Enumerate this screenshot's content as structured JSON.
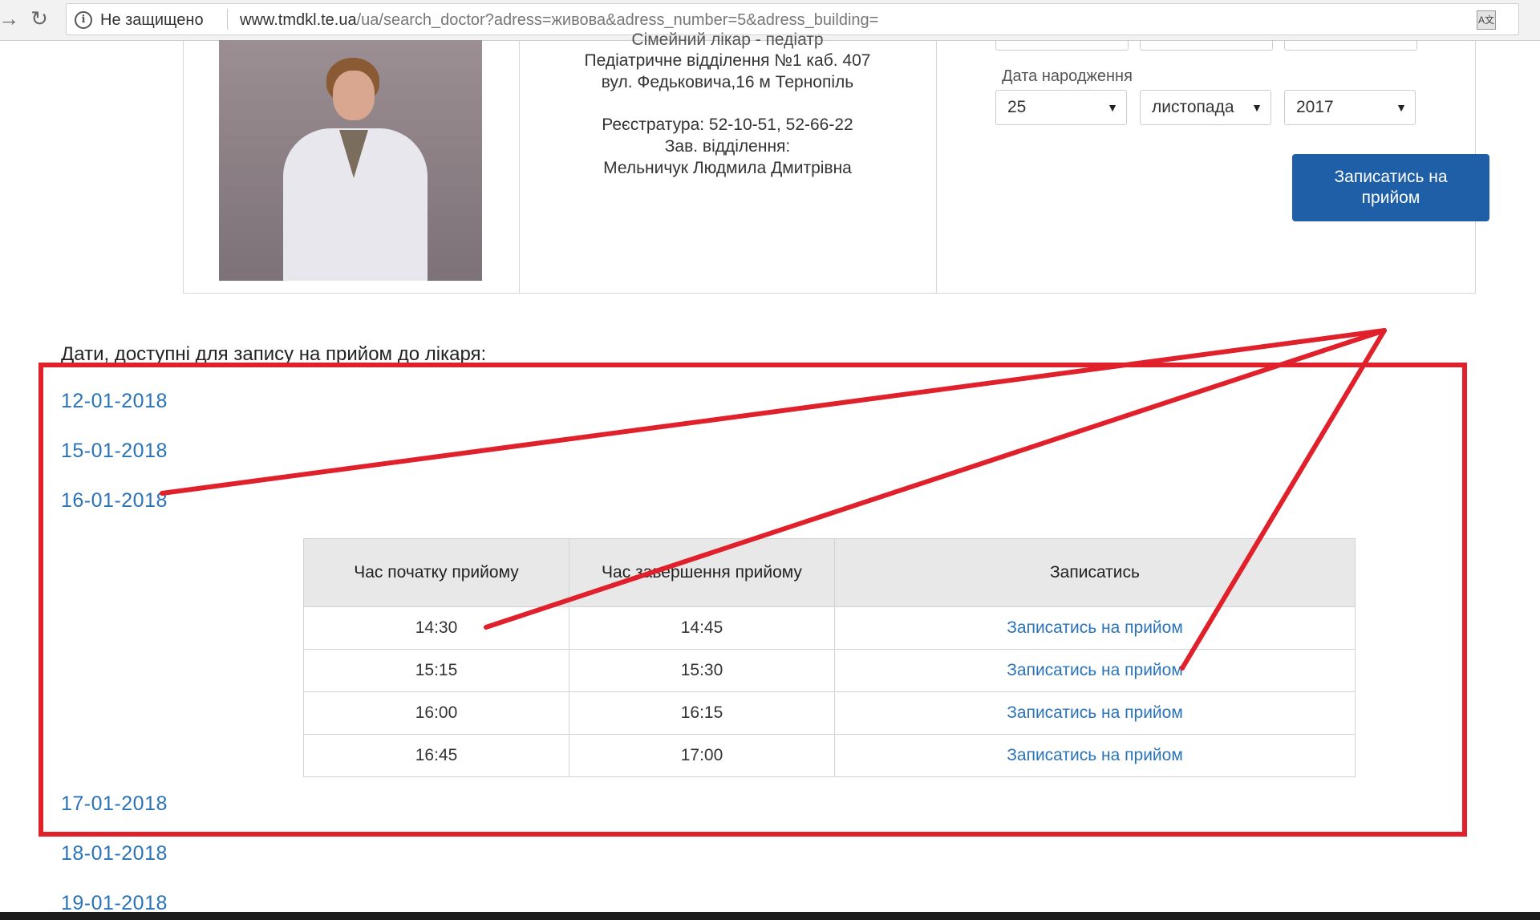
{
  "browser": {
    "security_text": "Не защищено",
    "url_host": "www.tmdkl.te.ua",
    "url_path": "/ua/search_doctor?adress=живова&adress_number=5&adress_building="
  },
  "doctor": {
    "cut_off_line": "Сімейний лікар - педіатр",
    "department": "Педіатричне відділення №1  каб. 407",
    "address": "вул. Федьковича,16 м Тернопіль",
    "registry": "Реєстратура: 52-10-51, 52-66-22",
    "head_label": "Зав. відділення:",
    "head_name": "Мельничук Людмила Дмитрівна"
  },
  "form": {
    "birth_label": "Дата народження",
    "day": "25",
    "month": "листопада",
    "year": "2017",
    "submit_label": "Записатись на прийом"
  },
  "dates": {
    "heading": "Дати, доступні для запису на прийом до лікаря:",
    "items": [
      "12-01-2018",
      "15-01-2018",
      "16-01-2018",
      "17-01-2018",
      "18-01-2018",
      "19-01-2018"
    ]
  },
  "schedule": {
    "headers": [
      "Час початку прийому",
      "Час завершення прийому",
      "Записатись"
    ],
    "rows": [
      {
        "start": "14:30",
        "end": "14:45",
        "action": "Записатись на прийом"
      },
      {
        "start": "15:15",
        "end": "15:30",
        "action": "Записатись на прийом"
      },
      {
        "start": "16:00",
        "end": "16:15",
        "action": "Записатись на прийом"
      },
      {
        "start": "16:45",
        "end": "17:00",
        "action": "Записатись на прийом"
      }
    ]
  },
  "colors": {
    "link": "#2a73b8",
    "button": "#1f5fa8",
    "annotation": "#e0202a"
  }
}
